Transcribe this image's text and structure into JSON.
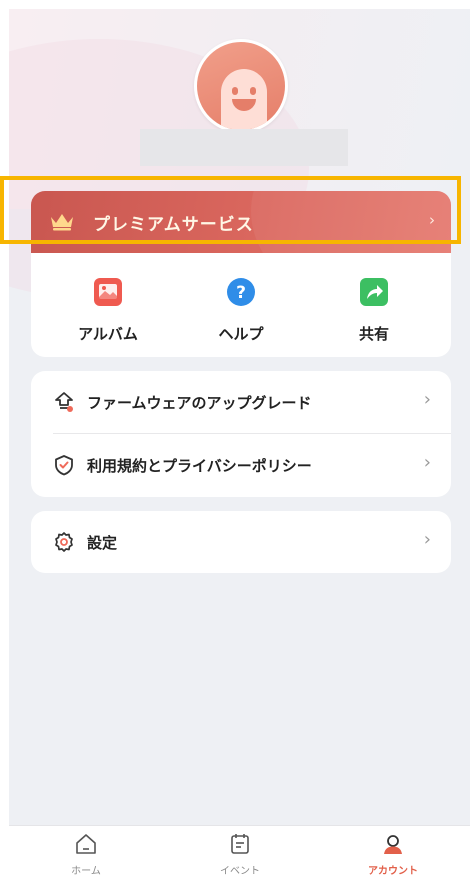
{
  "profile": {
    "avatar_icon": "smiley-avatar",
    "username": ""
  },
  "premium": {
    "label": "プレミアムサービス",
    "icon": "crown-icon",
    "chevron": "›",
    "color_start": "#c95750",
    "color_end": "#e67a70"
  },
  "shortcuts": [
    {
      "label": "アルバム",
      "icon": "album-icon",
      "color": "#ef5a50"
    },
    {
      "label": "ヘルプ",
      "icon": "help-icon",
      "color": "#2f8de8"
    },
    {
      "label": "共有",
      "icon": "share-icon",
      "color": "#3cbf62"
    }
  ],
  "menu": {
    "firmware": {
      "label": "ファームウェアのアップグレード",
      "icon": "firmware-upgrade-icon",
      "chevron": "›"
    },
    "terms": {
      "label": "利用規約とプライバシーポリシー",
      "icon": "shield-check-icon",
      "chevron": "›"
    },
    "settings": {
      "label": "設定",
      "icon": "gear-icon",
      "chevron": "›"
    }
  },
  "tabbar": {
    "tabs": [
      {
        "label": "ホーム",
        "icon": "home-icon",
        "active": false
      },
      {
        "label": "イベント",
        "icon": "event-list-icon",
        "active": false
      },
      {
        "label": "アカウント",
        "icon": "account-icon",
        "active": true
      }
    ],
    "active_color": "#e2604a"
  }
}
